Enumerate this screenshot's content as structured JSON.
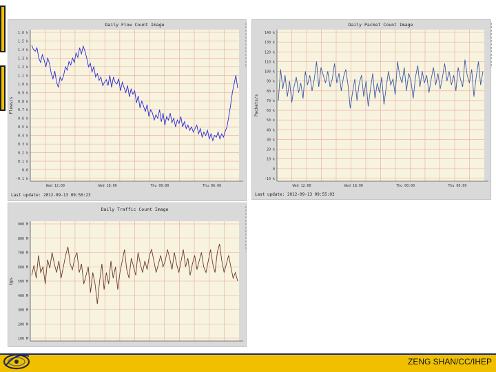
{
  "footer": {
    "credit": "ZENG SHAN/CC/IHEP"
  },
  "colors": {
    "accent": "#f0c000",
    "navy": "#1c2b66"
  },
  "chart_data": [
    {
      "type": "line",
      "title": "Daily Flow Count Image",
      "ylabel": "Flows/s",
      "yticks": [
        "1.6 k",
        "1.5 k",
        "1.4 k",
        "1.3 k",
        "1.2 k",
        "1.1 k",
        "1.0 k",
        "0.9 k",
        "0.8 k",
        "0.7 k",
        "0.6 k",
        "0.5 k",
        "0.4 k",
        "0.3 k",
        "0.2 k",
        "0.1 k",
        "0.0",
        "-0.1 k"
      ],
      "ylim": [
        -0.1,
        1.6
      ],
      "xticks": [
        "Wed 12:00",
        "Wed 18:00",
        "Thu 00:00",
        "Thu 06:00"
      ],
      "last_update": "Last update: 2012-09-13 09:50:23",
      "color": "#2a2ad8",
      "values": [
        1.45,
        1.4,
        1.38,
        1.42,
        1.3,
        1.25,
        1.34,
        1.28,
        1.2,
        1.3,
        1.24,
        1.12,
        1.06,
        1.15,
        1.02,
        0.96,
        1.08,
        1.04,
        1.1,
        1.2,
        1.16,
        1.26,
        1.22,
        1.3,
        1.25,
        1.36,
        1.31,
        1.42,
        1.35,
        1.44,
        1.38,
        1.3,
        1.2,
        1.24,
        1.14,
        1.2,
        1.08,
        1.12,
        1.04,
        1.08,
        0.98,
        1.02,
        1.05,
        0.98,
        1.1,
        0.96,
        1.08,
        1.02,
        1.0,
        1.06,
        0.92,
        1.02,
        0.96,
        0.9,
        0.98,
        0.85,
        0.94,
        0.88,
        0.92,
        0.78,
        0.86,
        0.72,
        0.8,
        0.74,
        0.68,
        0.76,
        0.62,
        0.7,
        0.66,
        0.58,
        0.64,
        0.6,
        0.7,
        0.56,
        0.66,
        0.52,
        0.62,
        0.58,
        0.66,
        0.55,
        0.6,
        0.5,
        0.58,
        0.54,
        0.62,
        0.5,
        0.56,
        0.48,
        0.52,
        0.46,
        0.5,
        0.44,
        0.48,
        0.52,
        0.42,
        0.48,
        0.38,
        0.44,
        0.4,
        0.46,
        0.36,
        0.42,
        0.34,
        0.4,
        0.38,
        0.44,
        0.36,
        0.42,
        0.38,
        0.45,
        0.5,
        0.62,
        0.75,
        0.9,
        1.0,
        1.1,
        0.95
      ]
    },
    {
      "type": "line",
      "title": "Daily Packet Count Image",
      "ylabel": "Packets/s",
      "yticks": [
        "140 k",
        "130 k",
        "120 k",
        "110 k",
        "100 k",
        "90 k",
        "80 k",
        "70 k",
        "60 k",
        "50 k",
        "40 k",
        "30 k",
        "20 k",
        "10 k",
        "0",
        "-10 k"
      ],
      "ylim": [
        -10,
        140
      ],
      "xticks": [
        "Wed 12:00",
        "Wed 18:00",
        "Thu 00:00",
        "Thu 06:00"
      ],
      "last_update": "Last update: 2012-09-13 09:55:03",
      "color": "#3a5aa8",
      "values": [
        70,
        102,
        82,
        96,
        74,
        90,
        68,
        84,
        94,
        78,
        88,
        72,
        100,
        86,
        96,
        80,
        92,
        110,
        84,
        104,
        96,
        88,
        100,
        84,
        92,
        108,
        88,
        98,
        80,
        94,
        102,
        86,
        62,
        78,
        92,
        70,
        88,
        96,
        74,
        90,
        64,
        82,
        98,
        72,
        88,
        78,
        94,
        66,
        84,
        100,
        86,
        92,
        76,
        110,
        96,
        88,
        104,
        80,
        98,
        90,
        72,
        94,
        106,
        84,
        100,
        88,
        96,
        78,
        92,
        104,
        86,
        98,
        82,
        94,
        108,
        90,
        100,
        86,
        96,
        80,
        104,
        92,
        84,
        112,
        96,
        88,
        102,
        74,
        94,
        110,
        86,
        100
      ]
    },
    {
      "type": "line",
      "title": "Daily Traffic Count Image",
      "ylabel": "bps",
      "yticks": [
        "900 M",
        "800 M",
        "700 M",
        "600 M",
        "500 M",
        "400 M",
        "300 M",
        "200 M",
        "100 M"
      ],
      "ylim": [
        100,
        900
      ],
      "xticks": [],
      "color": "#6b3a28",
      "values": [
        540,
        610,
        520,
        680,
        560,
        600,
        480,
        650,
        590,
        700,
        620,
        560,
        640,
        520,
        600,
        680,
        740,
        620,
        580,
        660,
        700,
        560,
        620,
        480,
        540,
        600,
        420,
        560,
        480,
        340,
        500,
        620,
        440,
        560,
        480,
        640,
        520,
        600,
        440,
        560,
        640,
        720,
        580,
        520,
        660,
        600,
        540,
        700,
        620,
        560,
        640,
        580,
        680,
        720,
        640,
        560,
        620,
        680,
        600,
        640,
        720,
        660,
        580,
        700,
        620,
        560,
        640,
        720,
        600,
        660,
        540,
        620,
        680,
        580,
        640,
        700,
        600,
        560,
        640,
        720,
        620,
        560,
        700,
        760,
        640,
        560,
        620,
        680,
        600,
        520,
        560,
        500
      ]
    }
  ]
}
